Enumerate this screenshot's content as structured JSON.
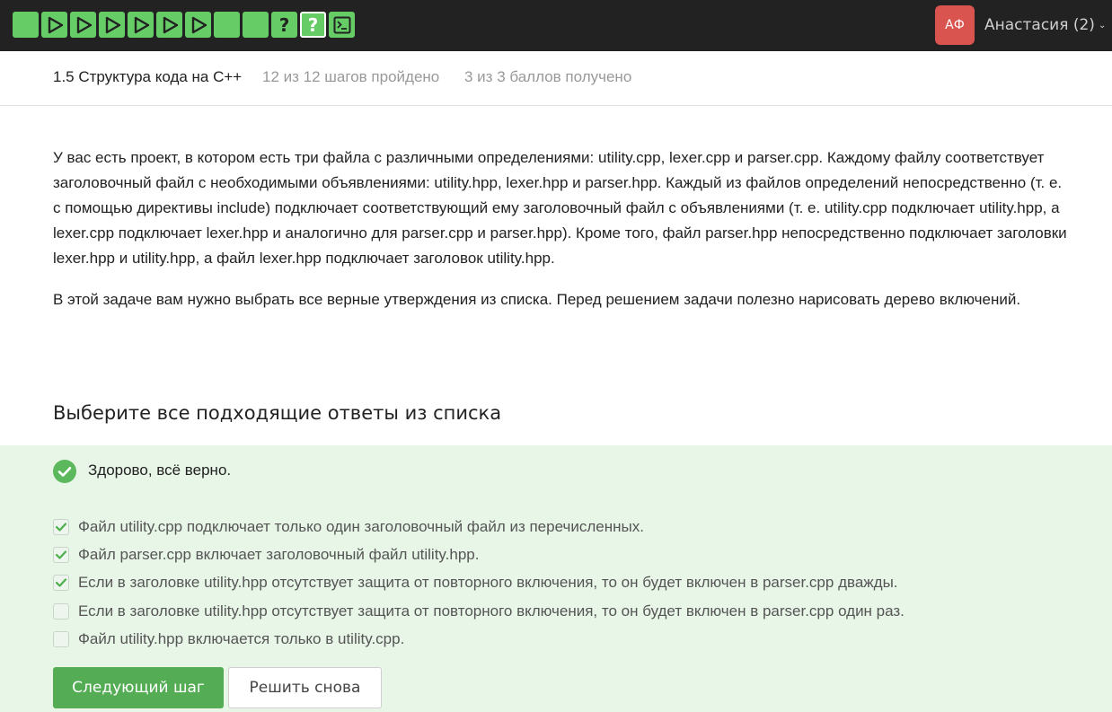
{
  "colors": {
    "topbar_bg": "#222222",
    "step_green": "#66cc66",
    "avatar_bg": "#d9534f",
    "answer_bg": "#e8f6e8",
    "button_green": "#54ad54",
    "check_green": "#5cb85c"
  },
  "topbar": {
    "steps": [
      {
        "type": "text",
        "icon": "text-step-icon"
      },
      {
        "type": "video",
        "icon": "play-icon"
      },
      {
        "type": "video",
        "icon": "play-icon"
      },
      {
        "type": "video",
        "icon": "play-icon"
      },
      {
        "type": "video",
        "icon": "play-icon"
      },
      {
        "type": "video",
        "icon": "play-icon"
      },
      {
        "type": "video",
        "icon": "play-icon"
      },
      {
        "type": "text",
        "icon": "text-step-icon"
      },
      {
        "type": "text",
        "icon": "text-step-icon"
      },
      {
        "type": "quiz",
        "icon": "question-icon",
        "label": "?"
      },
      {
        "type": "quiz",
        "icon": "question-icon",
        "label": "?",
        "active": true
      },
      {
        "type": "code",
        "icon": "terminal-icon"
      }
    ],
    "avatar_initials": "АФ",
    "user_name": "Анастасия (2)",
    "user_chevron": "⌄"
  },
  "lesson": {
    "title": "1.5 Структура кода на C++",
    "steps_progress": "12 из 12 шагов пройдено",
    "score": "3 из 3 баллов  получено"
  },
  "content": {
    "paragraph1": "У вас есть проект, в котором есть три файла с различными определениями: utility.cpp, lexer.cpp и parser.cpp. Каждому файлу соответствует заголовочный файл с необходимыми объявлениями: utility.hpp, lexer.hpp и parser.hpp. Каждый из файлов определений непосредственно (т. е. с помощью директивы include) подключает соответствующий ему заголовочный файл с объявлениями (т. е. utility.cpp подключает utility.hpp, а lexer.cpp подключает lexer.hpp и аналогично для parser.cpp и parser.hpp). Кроме того, файл parser.hpp непосредственно подключает заголовки lexer.hpp и utility.hpp, а файл lexer.hpp подключает заголовок utility.hpp.",
    "paragraph2": "В этой задаче вам нужно выбрать все верные утверждения из списка. Перед решением задачи полезно нарисовать дерево включений."
  },
  "quiz": {
    "title": "Выберите все подходящие ответы из списка",
    "result_message": "Здорово, всё верно.",
    "options": [
      {
        "label": "Файл utility.cpp подключает только один заголовочный файл из перечисленных.",
        "checked": true
      },
      {
        "label": "Файл parser.cpp включает заголовочный файл utility.hpp.",
        "checked": true
      },
      {
        "label": "Если в заголовке utility.hpp отсутствует защита от повторного включения, то он будет включен в parser.cpp дважды.",
        "checked": true
      },
      {
        "label": "Если в заголовке utility.hpp отсутствует защита от повторного включения, то он будет включен в parser.cpp один раз.",
        "checked": false
      },
      {
        "label": "Файл utility.hpp включается только в utility.cpp.",
        "checked": false
      }
    ],
    "next_button": "Следующий шаг",
    "retry_button": "Решить снова"
  }
}
